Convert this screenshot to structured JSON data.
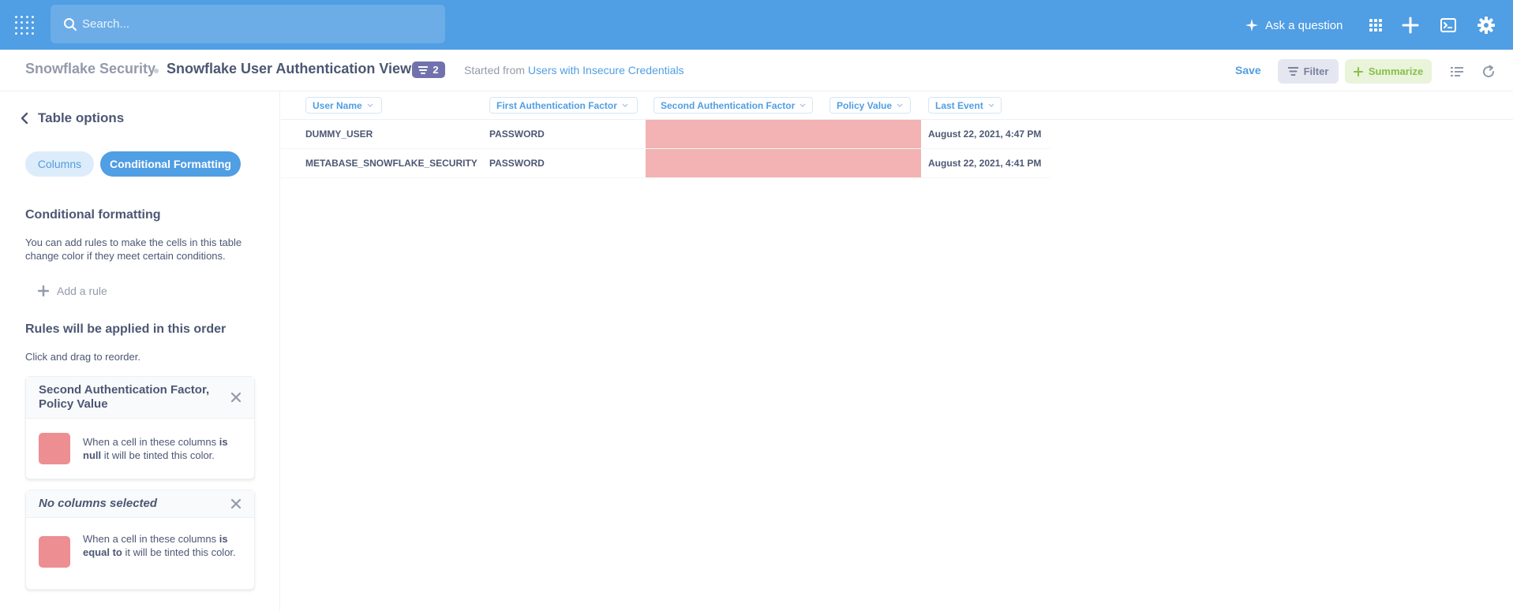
{
  "topnav": {
    "search_placeholder": "Search...",
    "ask_label": "Ask a question",
    "icons": [
      "apps-grid-icon",
      "plus-icon",
      "sql-editor-icon",
      "gear-icon"
    ],
    "color": "#509ee3"
  },
  "header": {
    "collection": "Snowflake Security",
    "title": "Snowflake User Authentication View",
    "filter_count": "2",
    "started_from_prefix": "Started from",
    "started_from_link": "Users with Insecure Credentials",
    "save_label": "Save",
    "filter_label": "Filter",
    "summarize_label": "Summarize"
  },
  "sidebar": {
    "back_label": "Table options",
    "tabs": [
      {
        "label": "Columns",
        "active": false
      },
      {
        "label": "Conditional Formatting",
        "active": true
      }
    ],
    "cf_heading": "Conditional formatting",
    "cf_description_1": "You can add rules to make the cells in this table",
    "cf_description_2": "change color if they meet certain conditions.",
    "add_rule_label": "Add a rule",
    "order_heading": "Rules will be applied in this order",
    "order_hint": "Click and drag to reorder.",
    "rules": [
      {
        "columns_1": "Second Authentication Factor,",
        "columns_2": "Policy Value",
        "pre": "When a cell in these columns",
        "op": "is null",
        "post": "it will be tinted this color.",
        "color": "#ed8e93"
      },
      {
        "columns_1": "No columns selected",
        "pre": "When a cell in these columns",
        "op": "is equal to",
        "post": "it will be tinted this color.",
        "color": "#ed8e93"
      }
    ]
  },
  "table": {
    "columns": [
      "User Name",
      "First Authentication Factor",
      "Second Authentication Factor",
      "Policy Value",
      "Last Event"
    ],
    "rows": [
      {
        "user": "DUMMY_USER",
        "first": "PASSWORD",
        "second": "",
        "policy": "",
        "last": "August 22, 2021, 4:47 PM"
      },
      {
        "user": "METABASE_SNOWFLAKE_SECURITY",
        "first": "PASSWORD",
        "second": "",
        "policy": "",
        "last": "August 22, 2021, 4:41 PM"
      }
    ],
    "tint_color": "#f3b2b3"
  }
}
